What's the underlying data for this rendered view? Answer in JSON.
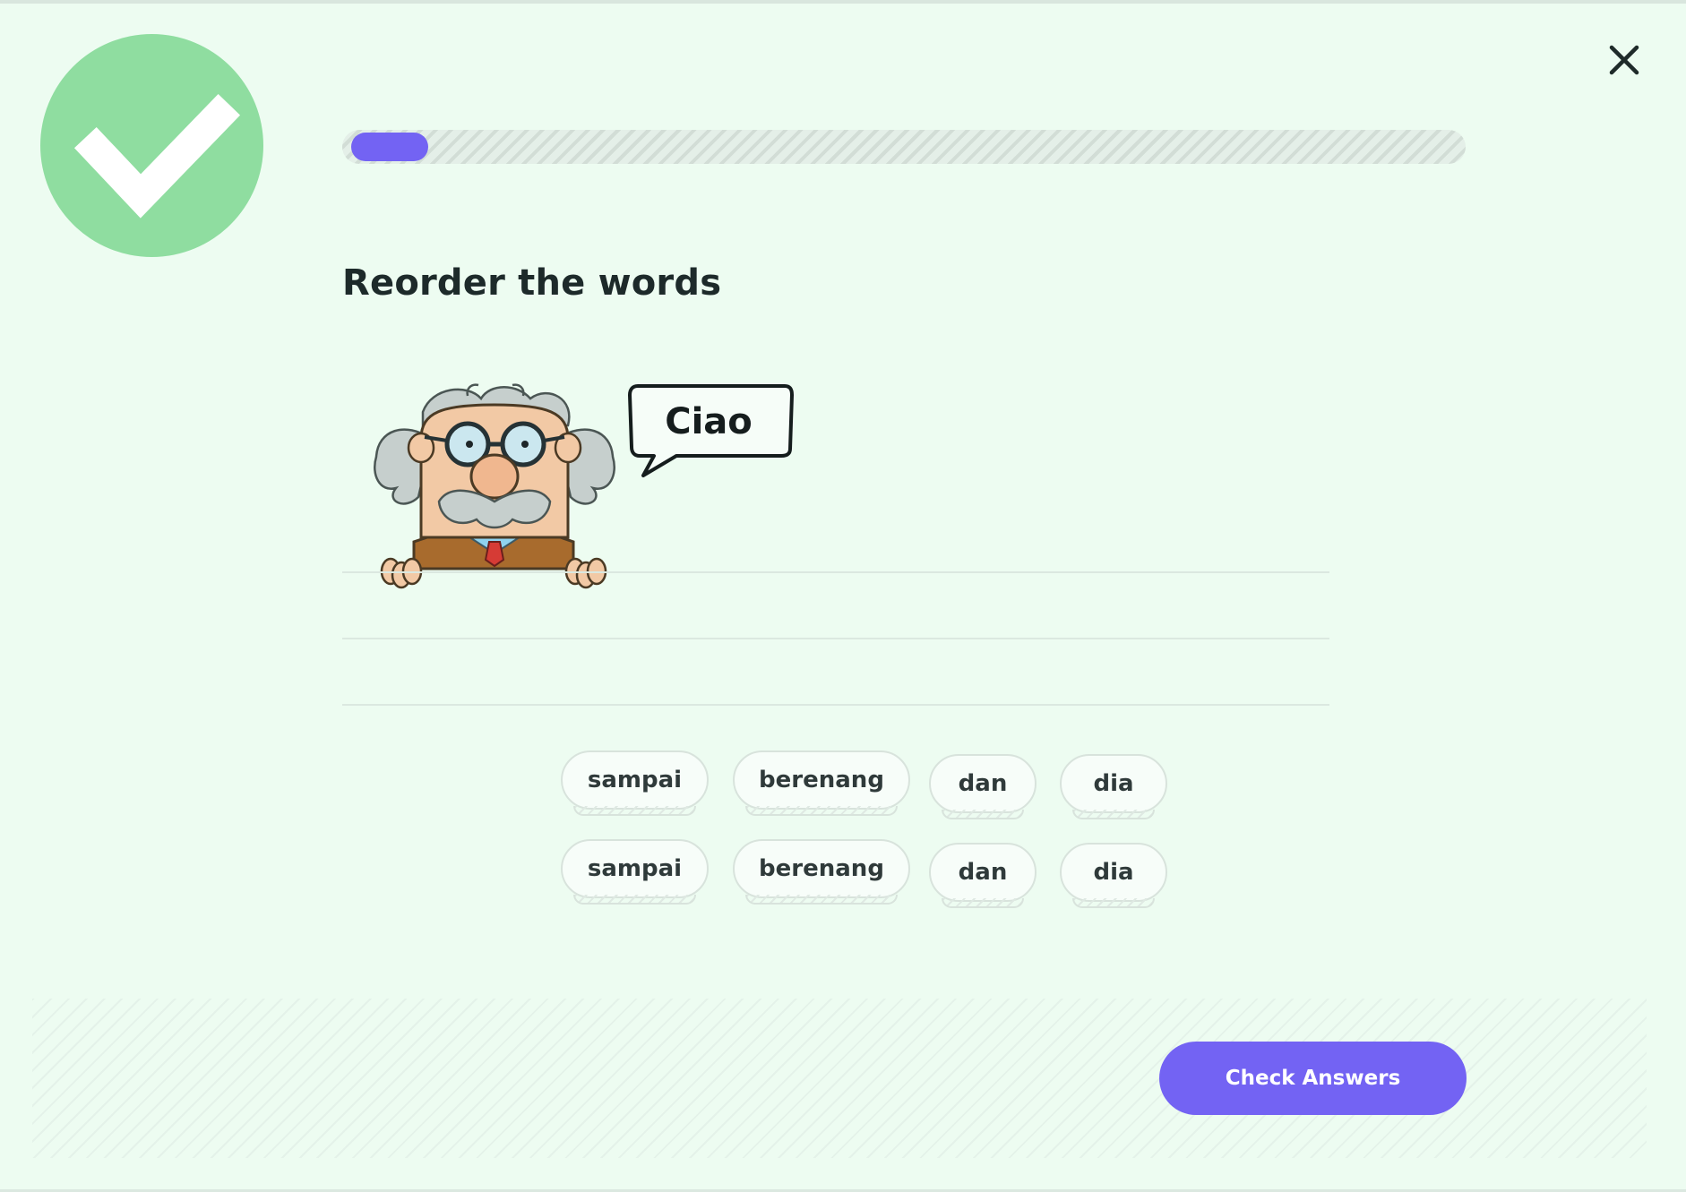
{
  "progress": {
    "fraction": 0.07
  },
  "lesson": {
    "title": "Reorder the words",
    "speech": "Ciao"
  },
  "word_bank": {
    "rows": [
      [
        "sampai",
        "berenang",
        "dan",
        "dia"
      ],
      [
        "sampai",
        "berenang",
        "dan",
        "dia"
      ]
    ]
  },
  "footer": {
    "check_label": "Check Answers"
  },
  "colors": {
    "accent": "#7363f3",
    "success": "#8fdda0",
    "background": "#edfcf1"
  },
  "icons": {
    "status": "checkmark-icon",
    "close": "close-icon",
    "mascot": "professor-mascot"
  }
}
